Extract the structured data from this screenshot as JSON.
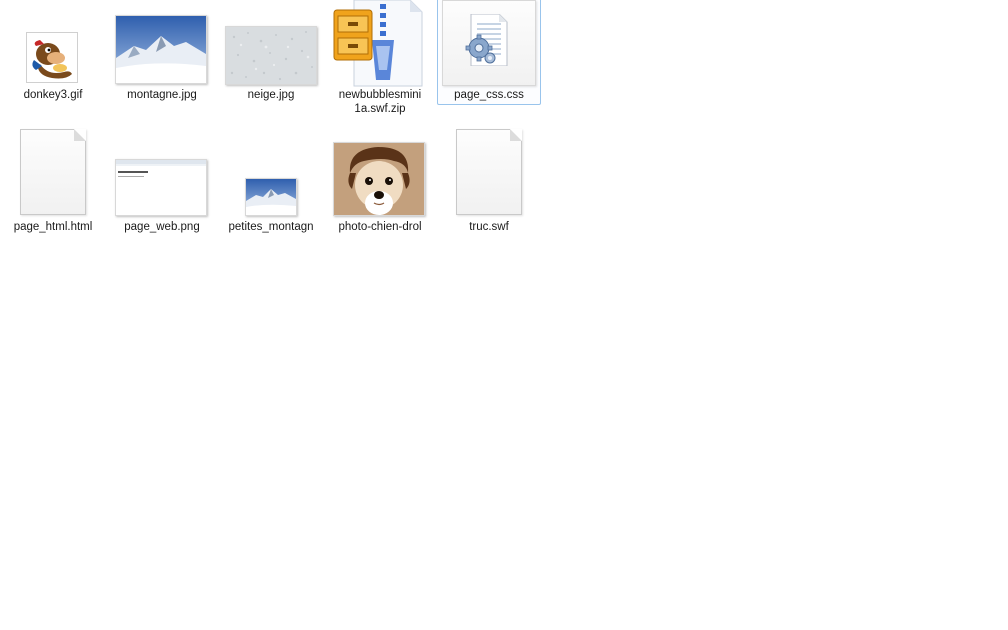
{
  "files": [
    {
      "name": "donkey3.gif",
      "icon": "donkey-gif-icon"
    },
    {
      "name": "montagne.jpg",
      "icon": "mountain-photo-icon"
    },
    {
      "name": "neige.jpg",
      "icon": "snow-photo-icon"
    },
    {
      "name": "newbubblesmini1a.swf.zip",
      "name_line1": "newbubblesmini",
      "name_line2": "1a.swf.zip",
      "icon": "zip-archive-icon"
    },
    {
      "name": "page_css.css",
      "icon": "css-file-icon",
      "selected": true
    },
    {
      "name": "page_html.html",
      "icon": "html-file-icon"
    },
    {
      "name": "page_web.png",
      "icon": "webpage-screenshot-icon"
    },
    {
      "name": "petites_montagn",
      "icon": "small-mountain-photo-icon"
    },
    {
      "name": "photo-chien-drol",
      "icon": "dog-photo-icon"
    },
    {
      "name": "truc.swf",
      "icon": "swf-file-icon"
    }
  ],
  "colors": {
    "selection_border": "#99c4ec",
    "label_text": "#1a1a1a"
  }
}
